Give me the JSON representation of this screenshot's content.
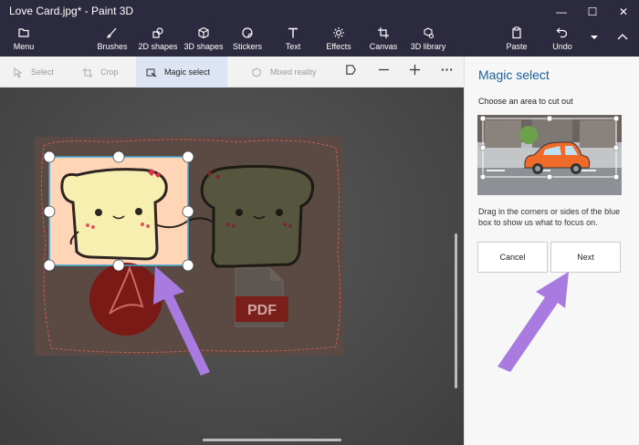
{
  "window": {
    "title": "Love Card.jpg* - Paint 3D",
    "controls": {
      "minimize": "—",
      "maximize": "☐",
      "close": "✕"
    }
  },
  "ribbon": {
    "menu": "Menu",
    "tools": [
      "Brushes",
      "2D shapes",
      "3D shapes",
      "Stickers",
      "Text",
      "Effects",
      "Canvas",
      "3D library"
    ],
    "paste": "Paste",
    "undo": "Undo"
  },
  "toolbar": {
    "select": "Select",
    "crop": "Crop",
    "magic_select": "Magic select",
    "mixed_reality": "Mixed reality"
  },
  "canvas": {
    "pdf_label": "PDF"
  },
  "panel": {
    "title": "Magic select",
    "description": "Choose an area to cut out",
    "help": "Drag in the corners or sides of the blue box to show us what to focus on.",
    "cancel": "Cancel",
    "next": "Next"
  },
  "colors": {
    "accent": "#1a5fa3",
    "annotation_arrow": "#a97be0",
    "selection_fill": "#ffd5b8",
    "card_bg": "#5b4a43",
    "pdf_red": "#9a2a2a"
  }
}
